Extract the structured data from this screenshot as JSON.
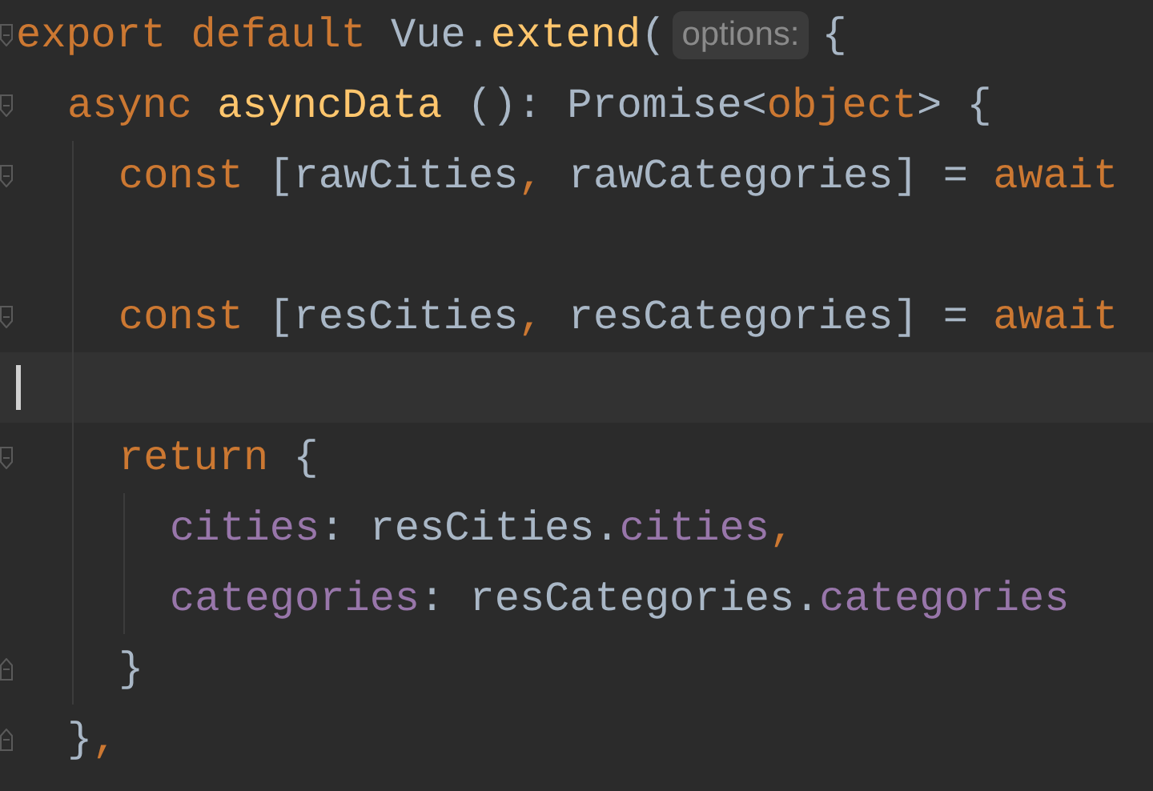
{
  "editor": {
    "lines": [
      {
        "kind": "code",
        "fold_start": true,
        "tokens": [
          {
            "kind": "keyword",
            "text": "export default "
          },
          {
            "kind": "plain",
            "text": "Vue."
          },
          {
            "kind": "function",
            "text": "extend"
          },
          {
            "kind": "plain",
            "text": "("
          },
          {
            "kind": "hint",
            "text": "options:"
          },
          {
            "kind": "plain",
            "text": "{"
          }
        ],
        "children": [
          {
            "kind": "code",
            "fold_start": true,
            "tokens": [
              {
                "kind": "keyword",
                "text": "async "
              },
              {
                "kind": "function",
                "text": "asyncData"
              },
              {
                "kind": "plain",
                "text": " (): Promise<"
              },
              {
                "kind": "keyword",
                "text": "object"
              },
              {
                "kind": "plain",
                "text": "> {"
              }
            ],
            "children": [
              {
                "kind": "code",
                "fold_start": true,
                "tokens": [
                  {
                    "kind": "keyword",
                    "text": "const "
                  },
                  {
                    "kind": "plain",
                    "text": "[rawCities"
                  },
                  {
                    "kind": "keyword",
                    "text": ", "
                  },
                  {
                    "kind": "plain",
                    "text": "rawCategories] = "
                  },
                  {
                    "kind": "keyword",
                    "text": "await"
                  }
                ]
              },
              {
                "kind": "blank"
              },
              {
                "kind": "code",
                "fold_start": true,
                "tokens": [
                  {
                    "kind": "keyword",
                    "text": "const "
                  },
                  {
                    "kind": "plain",
                    "text": "[resCities"
                  },
                  {
                    "kind": "keyword",
                    "text": ", "
                  },
                  {
                    "kind": "plain",
                    "text": "resCategories] = "
                  },
                  {
                    "kind": "keyword",
                    "text": "await"
                  }
                ]
              },
              {
                "kind": "blank",
                "current": true
              },
              {
                "kind": "code",
                "fold_start": true,
                "tokens": [
                  {
                    "kind": "keyword",
                    "text": "return "
                  },
                  {
                    "kind": "plain",
                    "text": "{"
                  }
                ],
                "children": [
                  {
                    "kind": "code",
                    "tokens": [
                      {
                        "kind": "property",
                        "text": "cities"
                      },
                      {
                        "kind": "plain",
                        "text": ": resCities."
                      },
                      {
                        "kind": "property",
                        "text": "cities"
                      },
                      {
                        "kind": "keyword",
                        "text": ","
                      }
                    ]
                  },
                  {
                    "kind": "code",
                    "tokens": [
                      {
                        "kind": "property",
                        "text": "categories"
                      },
                      {
                        "kind": "plain",
                        "text": ": resCategories."
                      },
                      {
                        "kind": "property",
                        "text": "categories"
                      }
                    ]
                  }
                ]
              },
              {
                "kind": "code",
                "fold_start": false,
                "tokens": [
                  {
                    "kind": "plain",
                    "text": "}"
                  }
                ]
              }
            ]
          },
          {
            "kind": "code",
            "fold_start": false,
            "tokens": [
              {
                "kind": "plain",
                "text": "}"
              },
              {
                "kind": "keyword",
                "text": ","
              }
            ]
          }
        ]
      }
    ]
  }
}
